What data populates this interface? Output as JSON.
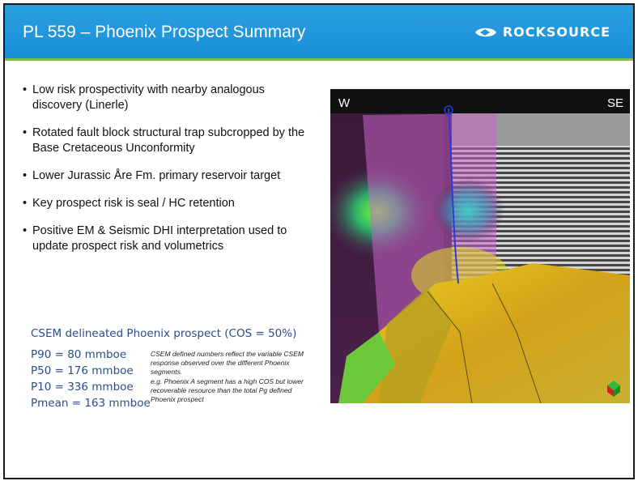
{
  "header": {
    "title": "PL 559 – Phoenix Prospect Summary",
    "logo_text": "ROCKSOURCE",
    "colors": {
      "header_blue": "#1f95da",
      "accent_green": "#7cc243"
    }
  },
  "bullets": [
    "Low risk prospectivity with nearby analogous discovery (Linerle)",
    "Rotated fault block structural trap subcropped by the Base Cretaceous Unconformity",
    "Lower Jurassic Åre Fm. primary reservoir target",
    "Key prospect risk is seal / HC retention",
    "Positive EM & Seismic DHI interpretation used to update prospect risk and volumetrics"
  ],
  "csem": {
    "heading": "CSEM delineated Phoenix prospect (COS = 50%)",
    "values": [
      "P90 = 80 mmboe",
      "P50 = 176 mmboe",
      "P10 = 336 mmboe",
      "Pmean = 163 mmboe"
    ],
    "notes": [
      "CSEM defined numbers reflect the variable CSEM response observed over the different Phoenix segments.",
      "e.g. Phoenix A segment has a high COS but lower recoverable resource than the total Pg defined Phoenix prospect"
    ]
  },
  "figure": {
    "label_left": "W",
    "label_right": "SE",
    "icons": [
      "well-path-icon",
      "compass-cube-icon"
    ]
  }
}
